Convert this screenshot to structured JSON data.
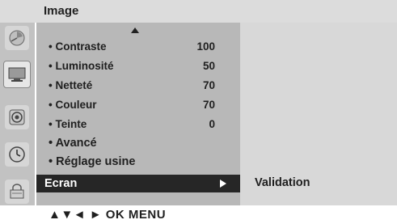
{
  "header": {
    "title": "Image"
  },
  "sidebar": {
    "icons": [
      {
        "name": "picture-icon",
        "active": false
      },
      {
        "name": "screen-icon",
        "active": true
      },
      {
        "name": "sound-icon",
        "active": false
      },
      {
        "name": "clock-icon",
        "active": false
      },
      {
        "name": "lock-icon",
        "active": false
      }
    ]
  },
  "menu": {
    "scroll_up_indicator": "▲",
    "items": [
      {
        "label": "• Contraste",
        "value": "100"
      },
      {
        "label": "• Luminosité",
        "value": "50"
      },
      {
        "label": "• Netteté",
        "value": "70"
      },
      {
        "label": "• Couleur",
        "value": "70"
      },
      {
        "label": "• Teinte",
        "value": "0"
      },
      {
        "label": "• Avancé",
        "value": ""
      },
      {
        "label": "• Réglage usine",
        "value": ""
      }
    ],
    "selected": {
      "label": "Ecran",
      "arrow": "►"
    }
  },
  "sub_panel": {
    "item": "Validation"
  },
  "footer": {
    "navigation": "▲▼◄ ► OK  MENU"
  },
  "colors": {
    "selected_bg": "#262626",
    "menu_bg": "#b8b8b8",
    "panel_bg": "#d8d8d8",
    "header_bg": "#dcdcdc"
  }
}
